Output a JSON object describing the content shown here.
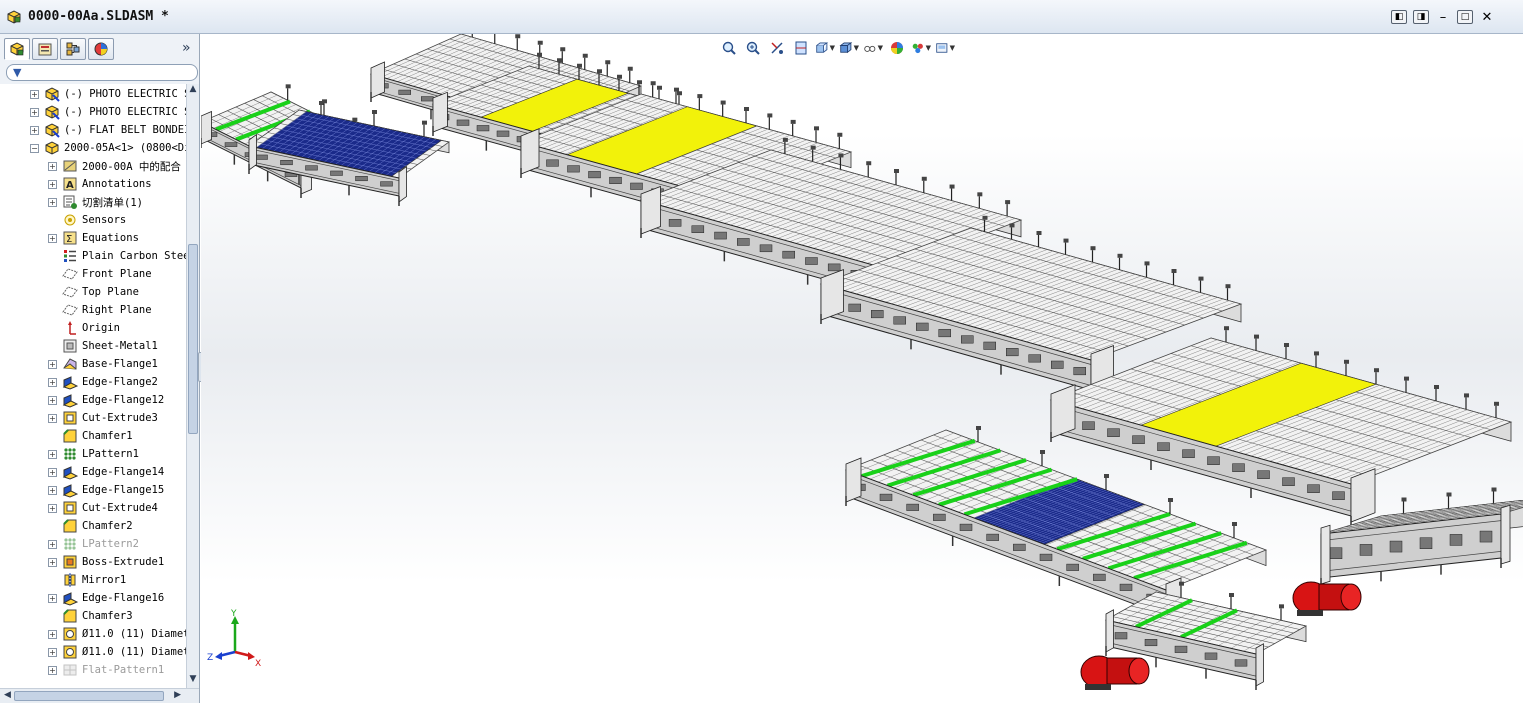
{
  "window": {
    "title": "0000-00Aa.SLDASM *",
    "buttons": [
      "restore-down",
      "restore-up",
      "minimize",
      "maximize",
      "close"
    ]
  },
  "panel": {
    "tabs": [
      "feature-manager",
      "property-manager",
      "configuration-manager",
      "display-manager"
    ],
    "collapse_glyph": "»",
    "filter_glyph": "▼"
  },
  "tree": [
    {
      "label": "(-) PHOTO ELECTRIC S",
      "level": 0,
      "expander": "+",
      "icon": "assembly-part-icon",
      "dim": false
    },
    {
      "label": "(-) PHOTO ELECTRIC S",
      "level": 0,
      "expander": "+",
      "icon": "assembly-part-icon",
      "dim": false
    },
    {
      "label": "(-) FLAT BELT BONDEI",
      "level": 0,
      "expander": "+",
      "icon": "assembly-part-icon",
      "dim": false
    },
    {
      "label": "2000-05A<1> (0800<Di",
      "level": 0,
      "expander": "-",
      "icon": "part-icon",
      "dim": false
    },
    {
      "label": "2000-00A 中的配合",
      "level": 1,
      "expander": "+",
      "icon": "mates-icon",
      "dim": false
    },
    {
      "label": "Annotations",
      "level": 1,
      "expander": "+",
      "icon": "annotations-icon",
      "dim": false
    },
    {
      "label": "切割清单(1)",
      "level": 1,
      "expander": "+",
      "icon": "cut-list-icon",
      "dim": false
    },
    {
      "label": "Sensors",
      "level": 1,
      "expander": "",
      "icon": "sensors-icon",
      "dim": false
    },
    {
      "label": "Equations",
      "level": 1,
      "expander": "+",
      "icon": "equations-icon",
      "dim": false
    },
    {
      "label": "Plain Carbon Stee",
      "level": 1,
      "expander": "",
      "icon": "material-icon",
      "dim": false
    },
    {
      "label": "Front Plane",
      "level": 1,
      "expander": "",
      "icon": "plane-icon",
      "dim": false
    },
    {
      "label": "Top Plane",
      "level": 1,
      "expander": "",
      "icon": "plane-icon",
      "dim": false
    },
    {
      "label": "Right Plane",
      "level": 1,
      "expander": "",
      "icon": "plane-icon",
      "dim": false
    },
    {
      "label": "Origin",
      "level": 1,
      "expander": "",
      "icon": "origin-icon",
      "dim": false
    },
    {
      "label": "Sheet-Metal1",
      "level": 1,
      "expander": "",
      "icon": "sheet-metal-icon",
      "dim": false
    },
    {
      "label": "Base-Flange1",
      "level": 1,
      "expander": "+",
      "icon": "base-flange-icon",
      "dim": false
    },
    {
      "label": "Edge-Flange2",
      "level": 1,
      "expander": "+",
      "icon": "edge-flange-icon",
      "dim": false
    },
    {
      "label": "Edge-Flange12",
      "level": 1,
      "expander": "+",
      "icon": "edge-flange-icon",
      "dim": false
    },
    {
      "label": "Cut-Extrude3",
      "level": 1,
      "expander": "+",
      "icon": "cut-extrude-icon",
      "dim": false
    },
    {
      "label": "Chamfer1",
      "level": 1,
      "expander": "",
      "icon": "chamfer-icon",
      "dim": false
    },
    {
      "label": "LPattern1",
      "level": 1,
      "expander": "+",
      "icon": "linear-pattern-icon",
      "dim": false
    },
    {
      "label": "Edge-Flange14",
      "level": 1,
      "expander": "+",
      "icon": "edge-flange-icon",
      "dim": false
    },
    {
      "label": "Edge-Flange15",
      "level": 1,
      "expander": "+",
      "icon": "edge-flange-icon",
      "dim": false
    },
    {
      "label": "Cut-Extrude4",
      "level": 1,
      "expander": "+",
      "icon": "cut-extrude-icon",
      "dim": false
    },
    {
      "label": "Chamfer2",
      "level": 1,
      "expander": "",
      "icon": "chamfer-icon",
      "dim": false
    },
    {
      "label": "LPattern2",
      "level": 1,
      "expander": "+",
      "icon": "linear-pattern-icon",
      "dim": true
    },
    {
      "label": "Boss-Extrude1",
      "level": 1,
      "expander": "+",
      "icon": "boss-extrude-icon",
      "dim": false
    },
    {
      "label": "Mirror1",
      "level": 1,
      "expander": "",
      "icon": "mirror-icon",
      "dim": false
    },
    {
      "label": "Edge-Flange16",
      "level": 1,
      "expander": "+",
      "icon": "edge-flange-icon",
      "dim": false
    },
    {
      "label": "Chamfer3",
      "level": 1,
      "expander": "",
      "icon": "chamfer-icon",
      "dim": false
    },
    {
      "label": "Ø11.0 (11) Diamet",
      "level": 1,
      "expander": "+",
      "icon": "hole-wizard-icon",
      "dim": false
    },
    {
      "label": "Ø11.0 (11) Diamet",
      "level": 1,
      "expander": "+",
      "icon": "hole-wizard-icon",
      "dim": false
    },
    {
      "label": "Flat-Pattern1",
      "level": 1,
      "expander": "+",
      "icon": "flat-pattern-icon",
      "dim": true
    }
  ],
  "viewtools": [
    "zoom-to-fit-icon",
    "zoom-to-area-icon",
    "previous-view-icon",
    "section-view-icon",
    "view-orientation-icon",
    "display-style-icon",
    "hide-show-icon",
    "edit-appearance-icon",
    "apply-scene-icon",
    "view-settings-icon"
  ],
  "triad": {
    "y": "Y",
    "z": "Z",
    "x": "X"
  },
  "colors": {
    "highlight_yellow": "#f2f20a",
    "belt_green": "#19d119",
    "mesh_blue": "#1a2a8a",
    "motor_red": "#d81414"
  }
}
